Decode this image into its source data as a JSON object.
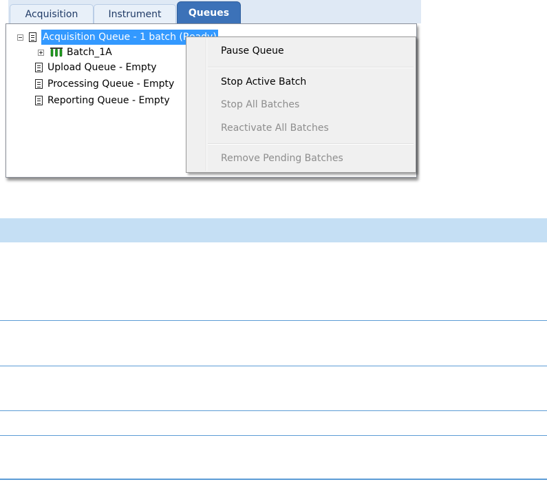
{
  "tabs": [
    {
      "label": "Acquisition"
    },
    {
      "label": "Instrument"
    },
    {
      "label": "Queues"
    }
  ],
  "tree": {
    "items": [
      {
        "label": "Acquisition Queue - 1 batch (Ready)",
        "expanded": true,
        "selected": true
      },
      {
        "label": "Batch_1A",
        "expanded": false
      },
      {
        "label": "Upload Queue - Empty"
      },
      {
        "label": "Processing Queue - Empty"
      },
      {
        "label": "Reporting Queue - Empty"
      }
    ]
  },
  "context_menu": {
    "items": [
      {
        "label": "Pause Queue",
        "enabled": true
      },
      {
        "label": "Stop Active Batch",
        "enabled": true
      },
      {
        "label": "Stop All Batches",
        "enabled": false
      },
      {
        "label": "Reactivate All Batches",
        "enabled": false
      },
      {
        "label": "Remove Pending Batches",
        "enabled": false
      }
    ]
  },
  "colors": {
    "active_tab": "#3c72b8",
    "selection": "#3399ff",
    "table_header": "#c5dff4",
    "table_rule": "#5b9bd5",
    "disabled_text": "#8d8d8d"
  }
}
